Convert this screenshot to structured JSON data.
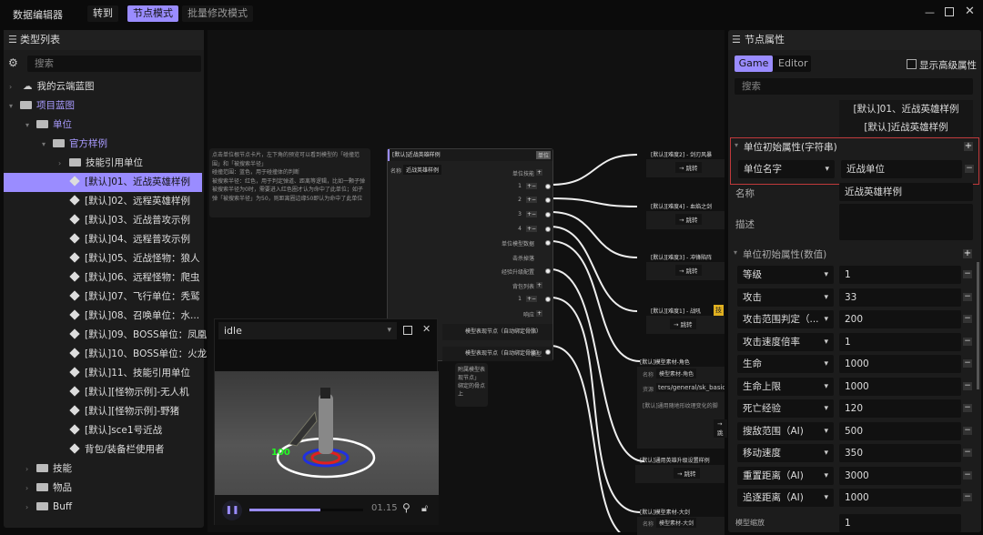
{
  "app": {
    "title": "数据编辑器",
    "goto": "转到",
    "mode_node": "节点模式",
    "mode_batch": "批量修改模式"
  },
  "colors": {
    "accent": "#9a8cff",
    "highlight_border": "#c0393b"
  },
  "left": {
    "title": "类型列表",
    "search_placeholder": "搜索",
    "items": [
      {
        "label": "我的云端蓝图",
        "depth": 0,
        "icon": "cloud-icon"
      },
      {
        "label": "项目蓝图",
        "depth": 0,
        "icon": "folder-icon"
      },
      {
        "label": "单位",
        "depth": 1,
        "icon": "folder-icon"
      },
      {
        "label": "官方样例",
        "depth": 2,
        "icon": "folder-icon"
      },
      {
        "label": "技能引用单位",
        "depth": 3,
        "icon": "folder-icon"
      },
      {
        "label": "[默认]01、近战英雄样例",
        "depth": 3,
        "icon": "cube-icon"
      },
      {
        "label": "[默认]02、远程英雄样例",
        "depth": 3,
        "icon": "cube-icon"
      },
      {
        "label": "[默认]03、近战普攻示例",
        "depth": 3,
        "icon": "cube-icon"
      },
      {
        "label": "[默认]04、远程普攻示例",
        "depth": 3,
        "icon": "cube-icon"
      },
      {
        "label": "[默认]05、近战怪物：狼人",
        "depth": 3,
        "icon": "cube-icon"
      },
      {
        "label": "[默认]06、远程怪物：爬虫",
        "depth": 3,
        "icon": "cube-icon"
      },
      {
        "label": "[默认]07、飞行单位：秃鹫",
        "depth": 3,
        "icon": "cube-icon"
      },
      {
        "label": "[默认]08、召唤单位：水...",
        "depth": 3,
        "icon": "cube-icon"
      },
      {
        "label": "[默认]09、BOSS单位：凤凰",
        "depth": 3,
        "icon": "cube-icon"
      },
      {
        "label": "[默认]10、BOSS单位：火龙",
        "depth": 3,
        "icon": "cube-icon"
      },
      {
        "label": "[默认]11、技能引用单位",
        "depth": 3,
        "icon": "cube-icon"
      },
      {
        "label": "[默认][怪物示例]-无人机",
        "depth": 3,
        "icon": "cube-icon"
      },
      {
        "label": "[默认][怪物示例]-野猪",
        "depth": 3,
        "icon": "cube-icon"
      },
      {
        "label": "[默认]sce1号近战",
        "depth": 3,
        "icon": "cube-icon"
      },
      {
        "label": "背包/装备栏使用者",
        "depth": 3,
        "icon": "cube-icon"
      },
      {
        "label": "技能",
        "depth": 1,
        "icon": "folder-icon"
      },
      {
        "label": "物品",
        "depth": 1,
        "icon": "folder-icon"
      },
      {
        "label": "Buff",
        "depth": 1,
        "icon": "folder-icon"
      }
    ]
  },
  "comment": {
    "text": "点击单位根节点卡片，左下角的预览可以看到模型的「碰撞范围」和「被搜索半径」\n碰撞范围：蓝色，用于碰撞体的判断\n被搜索半径：红色，用于判定弹道、距离等逻辑，比如一颗子弹被搜索半径为0时，需要进入红色圈才认为命中了此单位；如子弹「被搜索半径」为50，则距离圈边缘50即认为命中了此单位"
  },
  "main_node": {
    "title": "[默认]近战英雄样例",
    "tag": "单位",
    "name_label": "名称",
    "name_value": "近战英雄样例",
    "ports": [
      "单位技能",
      "1",
      "2",
      "3",
      "4",
      "单位模型数据",
      "击杀掉落",
      "经验升级配置",
      "背包列表",
      "1",
      "响应"
    ],
    "sub1": "模型表现节点（自动绑定骨骼）",
    "sub2": "模型表现节点（自动绑定骨骼）",
    "model_port": "模型",
    "note": "附属模型表现节点」\n绑定的骨点上"
  },
  "right_nodes": [
    {
      "title": "[默认][难度2] - 剑刃风暴",
      "jump": "→ 跳转"
    },
    {
      "title": "[默认][难度4] - 血焰之剑",
      "jump": "→ 跳转"
    },
    {
      "title": "[默认][难度3] - 冲锋陷阵",
      "jump": "→ 跳转"
    },
    {
      "title": "[默认][难度1] - 战吼",
      "jump": "→ 跳转",
      "badge": "技"
    },
    {
      "title": "[默认]模型素材-角色",
      "name_label": "名称",
      "name_value": "模型素材-角色",
      "res_label": "资源",
      "res_value": "ters/general/sk_basic2",
      "desc": "[默认]通用随地形纹理变化的脚",
      "jump": "→ 跳"
    },
    {
      "title": "[默认]通用英雄升级设置样例",
      "jump": "→ 跳转"
    },
    {
      "title": "[默认]模型素材-大剑",
      "name_label": "名称",
      "name_value": "模型素材-大剑"
    }
  ],
  "preview": {
    "animation": "idle",
    "time": "01.15",
    "progress": 0.62,
    "hp_label": "100"
  },
  "props": {
    "title": "节点属性",
    "tab_game": "Game",
    "tab_editor": "Editor",
    "advanced": "显示高级属性",
    "search_placeholder": "搜索",
    "header_line1": "[默认]01、近战英雄样例",
    "header_line2": "[默认]近战英雄样例",
    "str_section": "单位初始属性(字符串)",
    "str_key": "单位名字",
    "str_value": "近战单位",
    "name_label": "名称",
    "name_value": "近战英雄样例",
    "desc_label": "描述",
    "num_section": "单位初始属性(数值)",
    "num_rows": [
      {
        "key": "等级",
        "value": "1"
      },
      {
        "key": "攻击",
        "value": "33"
      },
      {
        "key": "攻击范围判定（...",
        "value": "200"
      },
      {
        "key": "攻击速度倍率",
        "value": "1"
      },
      {
        "key": "生命",
        "value": "1000"
      },
      {
        "key": "生命上限",
        "value": "1000"
      },
      {
        "key": "死亡经验",
        "value": "120"
      },
      {
        "key": "搜敌范围（AI)",
        "value": "500"
      },
      {
        "key": "移动速度",
        "value": "350"
      },
      {
        "key": "重置距离（AI)",
        "value": "3000"
      },
      {
        "key": "追逐距离（AI)",
        "value": "1000"
      }
    ],
    "last_label": "模型缩放",
    "last_value": "1"
  }
}
